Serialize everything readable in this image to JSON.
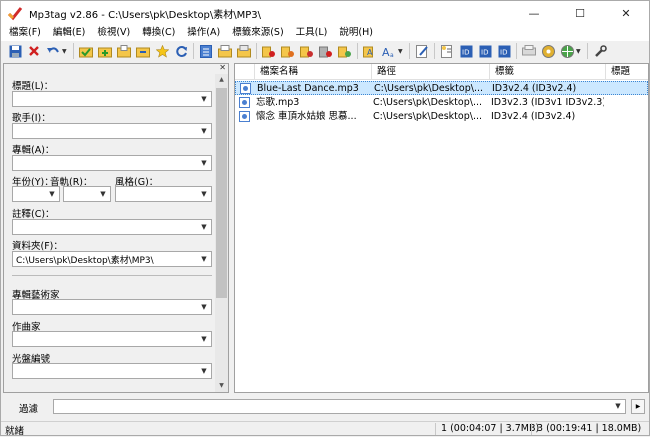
{
  "window": {
    "title": "Mp3tag v2.86  -  C:\\Users\\pk\\Desktop\\素材\\MP3\\",
    "minimize": "—",
    "maximize": "☐",
    "close": "✕"
  },
  "menu": {
    "items": [
      "檔案(F)",
      "編輯(E)",
      "檢視(V)",
      "轉換(C)",
      "操作(A)",
      "標籤來源(S)",
      "工具(L)",
      "說明(H)"
    ]
  },
  "tag_panel": {
    "title_label": "標題(L)：",
    "title_value": "",
    "artist_label": "歌手(I)：",
    "artist_value": "",
    "album_label": "專輯(A)：",
    "album_value": "",
    "year_label": "年份(Y)：",
    "year_value": "",
    "track_label": "音軌(R)：",
    "track_value": "",
    "genre_label": "風格(G)：",
    "genre_value": "",
    "comment_label": "註釋(C)：",
    "comment_value": "",
    "directory_label": "資料夾(F)：",
    "directory_value": "C:\\Users\\pk\\Desktop\\素材\\MP3\\",
    "album_artist_label": "專輯藝術家",
    "album_artist_value": "",
    "composer_label": "作曲家",
    "composer_value": "",
    "discnumber_label": "光盤編號",
    "discnumber_value": ""
  },
  "file_list": {
    "columns": [
      "檔案名稱",
      "路徑",
      "標籤",
      "標題"
    ],
    "rows": [
      {
        "filename": "Blue-Last Dance.mp3",
        "path": "C:\\Users\\pk\\Desktop\\...",
        "tag": "ID3v2.4 (ID3v2.4)",
        "title": "",
        "selected": true
      },
      {
        "filename": "忘歌.mp3",
        "path": "C:\\Users\\pk\\Desktop\\...",
        "tag": "ID3v2.3 (ID3v1 ID3v2.3)",
        "title": "",
        "selected": false
      },
      {
        "filename": "懷念  車頂水姑娘  思慕...",
        "path": "C:\\Users\\pk\\Desktop\\...",
        "tag": "ID3v2.4 (ID3v2.4)",
        "title": "",
        "selected": false
      }
    ]
  },
  "filter": {
    "label": "過濾",
    "value": ""
  },
  "status": {
    "state": "就緒",
    "selected_info": "1 (00:04:07 | 3.7MB)",
    "total_info": "3 (00:19:41 | 18.0MB)"
  },
  "colors": {
    "selection": "#cce8ff",
    "selection_border": "#3d86d1",
    "toolbar_bg": "#f0f0f0"
  }
}
